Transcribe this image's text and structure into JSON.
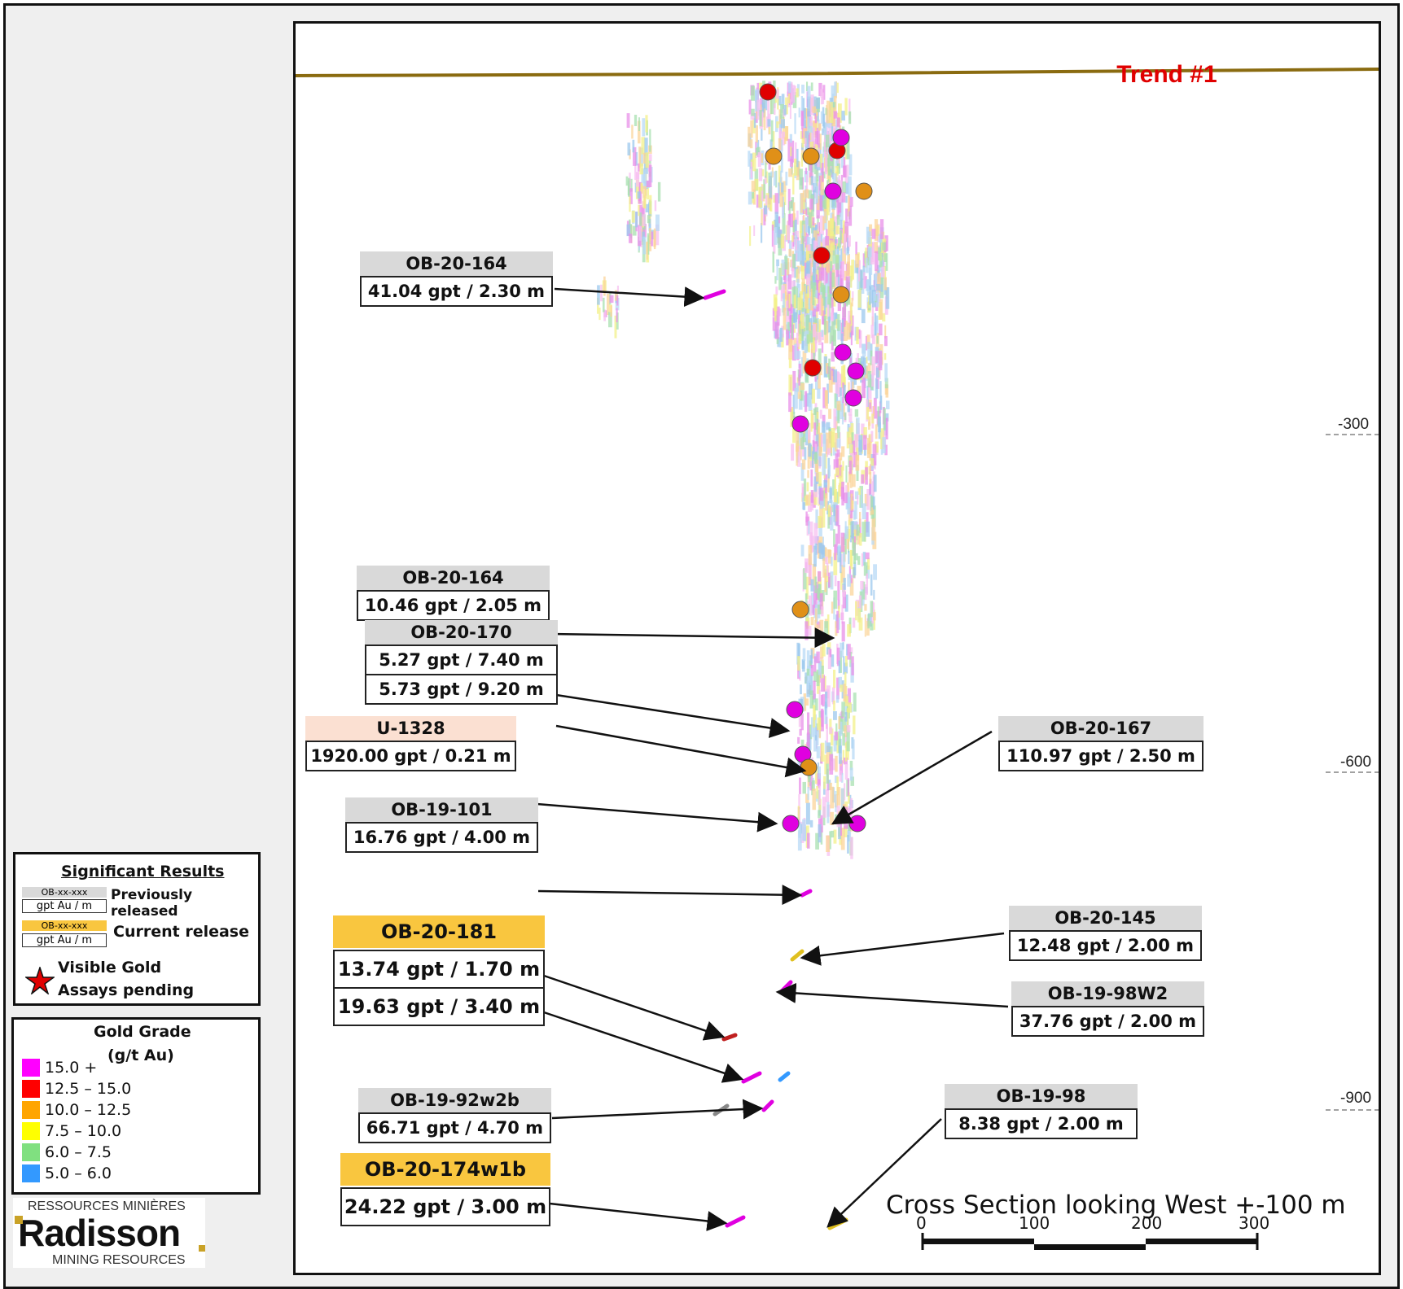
{
  "title": "Trend #1",
  "caption": "Cross Section looking West +-100 m",
  "depth_labels": [
    "-300",
    "-600",
    "-900"
  ],
  "scale_bar": {
    "ticks": [
      "0",
      "100",
      "200",
      "300"
    ]
  },
  "intercepts": [
    {
      "hole": "OB-20-164",
      "values": [
        "41.04 gpt / 2.30 m"
      ],
      "style": "prev"
    },
    {
      "hole": "OB-20-164",
      "values": [
        "10.46 gpt / 2.05 m"
      ],
      "style": "prev"
    },
    {
      "hole": "OB-20-170",
      "values": [
        "5.27 gpt / 7.40 m",
        "5.73 gpt / 9.20 m"
      ],
      "style": "prev"
    },
    {
      "hole": "U-1328",
      "values": [
        "1920.00 gpt / 0.21 m"
      ],
      "style": "peach"
    },
    {
      "hole": "OB-19-101",
      "values": [
        "16.76 gpt / 4.00 m"
      ],
      "style": "prev"
    },
    {
      "hole": "OB-20-181",
      "values": [
        "13.74 gpt / 1.70 m",
        "19.63 gpt / 3.40 m"
      ],
      "style": "current"
    },
    {
      "hole": "OB-19-92w2b",
      "values": [
        "66.71 gpt / 4.70 m"
      ],
      "style": "prev"
    },
    {
      "hole": "OB-20-174w1b",
      "values": [
        "24.22 gpt / 3.00 m"
      ],
      "style": "current"
    },
    {
      "hole": "OB-20-167",
      "values": [
        "110.97 gpt / 2.50 m"
      ],
      "style": "prev"
    },
    {
      "hole": "OB-20-145",
      "values": [
        "12.48 gpt / 2.00 m"
      ],
      "style": "prev"
    },
    {
      "hole": "OB-19-98W2",
      "values": [
        "37.76 gpt / 2.00 m"
      ],
      "style": "prev"
    },
    {
      "hole": "OB-19-98",
      "values": [
        "8.38 gpt / 2.00 m"
      ],
      "style": "prev"
    }
  ],
  "legend_results": {
    "title": "Significant Results",
    "sample_hole": "OB-xx-xxx",
    "sample_value": "gpt Au / m",
    "previously_released": "Previously released",
    "current_release": "Current release",
    "visible_gold_1": "Visible Gold",
    "visible_gold_2": "Assays pending"
  },
  "legend_grade": {
    "title_1": "Gold Grade",
    "title_2": "(g/t Au)",
    "classes": [
      {
        "label": "15.0 +",
        "color": "#ff00ff"
      },
      {
        "label": "12.5 – 15.0",
        "color": "#ff0000"
      },
      {
        "label": "10.0 – 12.5",
        "color": "#ffa500"
      },
      {
        "label": "7.5 – 10.0",
        "color": "#ffff00"
      },
      {
        "label": "6.0 – 7.5",
        "color": "#80e080"
      },
      {
        "label": "5.0 – 6.0",
        "color": "#3399ff"
      }
    ]
  },
  "logo": {
    "top": "RESSOURCES MINIÈRES",
    "name": "Radisson",
    "bottom": "MINING RESOURCES"
  },
  "colors": {
    "title": "#e00000",
    "surface": "#8a6b10",
    "current": "#f9c63f",
    "previous": "#d9d9d9",
    "peach": "#fbe0d2"
  }
}
